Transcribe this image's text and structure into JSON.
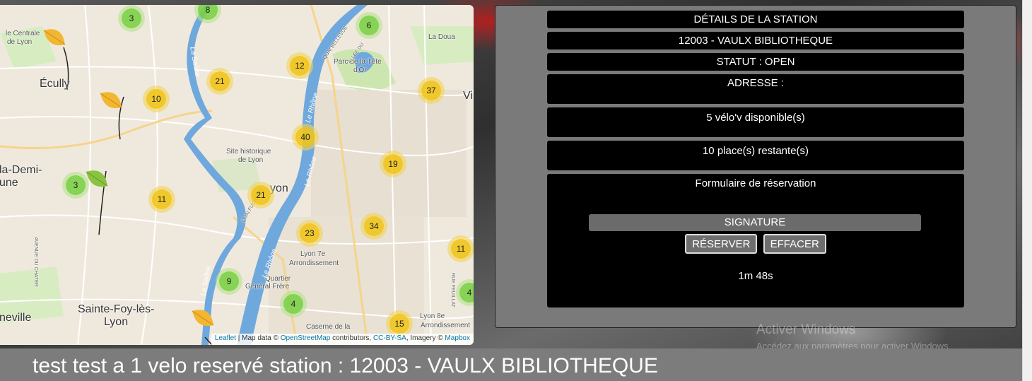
{
  "map": {
    "place_labels": [
      {
        "text": "Écully",
        "cls": "ml-big"
      },
      {
        "text": "la-Demi-",
        "cls": "ml-big"
      },
      {
        "text": "une",
        "cls": "ml-big"
      },
      {
        "text": "Sainte-Foy-lès-",
        "cls": "ml-big"
      },
      {
        "text": "Lyon",
        "cls": "ml-big"
      },
      {
        "text": "neville",
        "cls": "ml-big"
      },
      {
        "text": "yon",
        "cls": "ml-big"
      },
      {
        "text": "Vi",
        "cls": "ml-big"
      },
      {
        "text": "le Centrale",
        "cls": "ml-small"
      },
      {
        "text": "de Lyon",
        "cls": "ml-small"
      },
      {
        "text": "La Doua",
        "cls": "ml-small"
      },
      {
        "text": "Parc de la Tête",
        "cls": "ml-small"
      },
      {
        "text": "d'Or",
        "cls": "ml-small"
      },
      {
        "text": "Site historique",
        "cls": "ml-small"
      },
      {
        "text": "de Lyon",
        "cls": "ml-small"
      },
      {
        "text": "Lyon 7e",
        "cls": "ml-small"
      },
      {
        "text": "Arrondissement",
        "cls": "ml-small"
      },
      {
        "text": "Quartier",
        "cls": "ml-small"
      },
      {
        "text": "Général Frère",
        "cls": "ml-small"
      },
      {
        "text": "Lyon 8e",
        "cls": "ml-small"
      },
      {
        "text": "Arrondissement",
        "cls": "ml-small"
      },
      {
        "text": "Caserne de la",
        "cls": "ml-small"
      },
      {
        "text": "La Saône",
        "cls": "ml-river"
      },
      {
        "text": "Le Rhône",
        "cls": "ml-river"
      },
      {
        "text": "Le Rhône",
        "cls": "ml-river"
      },
      {
        "text": "Le Rhône",
        "cls": "ml-river"
      },
      {
        "text": "La Saône",
        "cls": "ml-river"
      },
      {
        "text": "QUAI BELLEVUE",
        "cls": "ml-street"
      },
      {
        "text": "ALLÉE DU",
        "cls": "ml-street"
      },
      {
        "text": "AVENUE DU CHATER",
        "cls": "ml-street"
      },
      {
        "text": "QUAI FUCHERIE",
        "cls": "ml-street"
      },
      {
        "text": "RUE FEUILLAT",
        "cls": "ml-street"
      }
    ],
    "clusters": [
      {
        "count": "3",
        "color": "green"
      },
      {
        "count": "8",
        "color": "green"
      },
      {
        "count": "6",
        "color": "green"
      },
      {
        "count": "12",
        "color": "yellow"
      },
      {
        "count": "21",
        "color": "yellow"
      },
      {
        "count": "10",
        "color": "yellow"
      },
      {
        "count": "37",
        "color": "yellow"
      },
      {
        "count": "40",
        "color": "yellow"
      },
      {
        "count": "19",
        "color": "yellow"
      },
      {
        "count": "3",
        "color": "green"
      },
      {
        "count": "11",
        "color": "yellow"
      },
      {
        "count": "21",
        "color": "yellow"
      },
      {
        "count": "34",
        "color": "yellow"
      },
      {
        "count": "23",
        "color": "yellow"
      },
      {
        "count": "11",
        "color": "yellow"
      },
      {
        "count": "9",
        "color": "green"
      },
      {
        "count": "4",
        "color": "green"
      },
      {
        "count": "15",
        "color": "yellow"
      },
      {
        "count": "4",
        "color": "green"
      }
    ],
    "attribution": {
      "leaflet": "Leaflet",
      "sep1": " | Map data © ",
      "osm": "OpenStreetMap",
      "sep2": " contributors, ",
      "ccbysa": "CC-BY-SA",
      "sep3": ", Imagery © ",
      "mapbox": "Mapbox"
    }
  },
  "panel": {
    "title": "DÉTAILS DE LA STATION",
    "station_name": "12003 - VAULX BIBLIOTHEQUE",
    "status": "STATUT : OPEN",
    "address": "ADRESSE :",
    "bikes_available": "5 vélo'v disponible(s)",
    "places_remaining": "10 place(s) restante(s)",
    "form": {
      "title": "Formulaire de réservation",
      "signature_label": "SIGNATURE",
      "reserve_button": "RÉSERVER",
      "clear_button": "EFFACER",
      "timer": "1m 48s"
    }
  },
  "watermark": {
    "title": "Activer Windows",
    "subtitle": "Accédez aux paramètres pour activer Windows."
  },
  "footer": {
    "reservation_text": "test test a 1 velo reservé station : 12003 - VAULX BIBLIOTHEQUE"
  },
  "colors": {
    "cluster_yellow": "#f0c20c",
    "cluster_green": "#6ecc39",
    "river": "#6fa8dc",
    "panel_bg": "#7a7a7a",
    "row_bg": "#000000"
  }
}
